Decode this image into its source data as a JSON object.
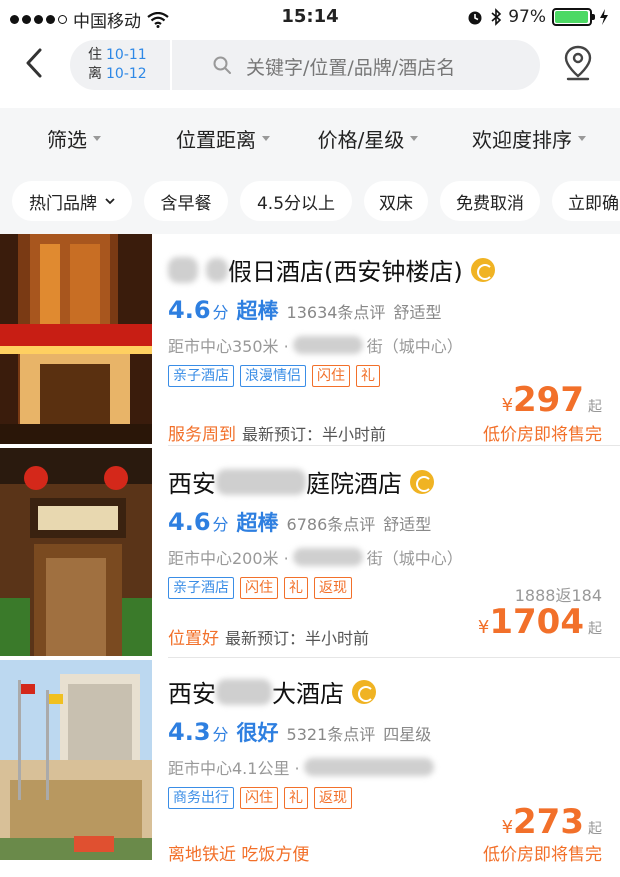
{
  "status_bar": {
    "carrier": "中国移动",
    "time": "15:14",
    "battery": "97%",
    "battery_level": 0.97
  },
  "header": {
    "checkin_label": "住",
    "checkin_date": "10-11",
    "checkout_label": "离",
    "checkout_date": "10-12",
    "search_placeholder": "关键字/位置/品牌/酒店名"
  },
  "filters": [
    "筛选",
    "位置距离",
    "价格/星级",
    "欢迎度排序"
  ],
  "chips": [
    "热门品牌",
    "含早餐",
    "4.5分以上",
    "双床",
    "免费取消",
    "立即确"
  ],
  "hotels": [
    {
      "name": "假日酒店(西安钟楼店)",
      "score": "4.6",
      "fen": "分",
      "praise": "超棒",
      "reviews": "13634条点评",
      "type": "舒适型",
      "distance": "距市中心350米 ·",
      "distance_tail": "街（城中心）",
      "tags": [
        "亲子酒店",
        "浪漫情侣",
        "闪住",
        "礼"
      ],
      "highlight": "服务周到",
      "latest": "最新预订：半小时前",
      "warning": "低价房即将售完",
      "currency": "¥",
      "price": "297",
      "qi": "起"
    },
    {
      "name_prefix": "西安",
      "name_suffix": "庭院酒店",
      "score": "4.6",
      "fen": "分",
      "praise": "超棒",
      "reviews": "6786条点评",
      "type": "舒适型",
      "distance": "距市中心200米 ·",
      "distance_tail": "街（城中心）",
      "tags": [
        "亲子酒店",
        "闪住",
        "礼",
        "返现"
      ],
      "cashback": "1888返184",
      "highlight": "位置好",
      "latest": "最新预订：半小时前",
      "currency": "¥",
      "price": "1704",
      "qi": "起"
    },
    {
      "name_prefix": "西安",
      "name_suffix": "大酒店",
      "score": "4.3",
      "fen": "分",
      "praise": "很好",
      "reviews": "5321条点评",
      "type": "四星级",
      "distance": "距市中心4.1公里 ·",
      "tags": [
        "商务出行",
        "闪住",
        "礼",
        "返现"
      ],
      "highlight": "离地铁近 吃饭方便",
      "warning": "低价房即将售完",
      "currency": "¥",
      "price": "273",
      "qi": "起"
    }
  ]
}
